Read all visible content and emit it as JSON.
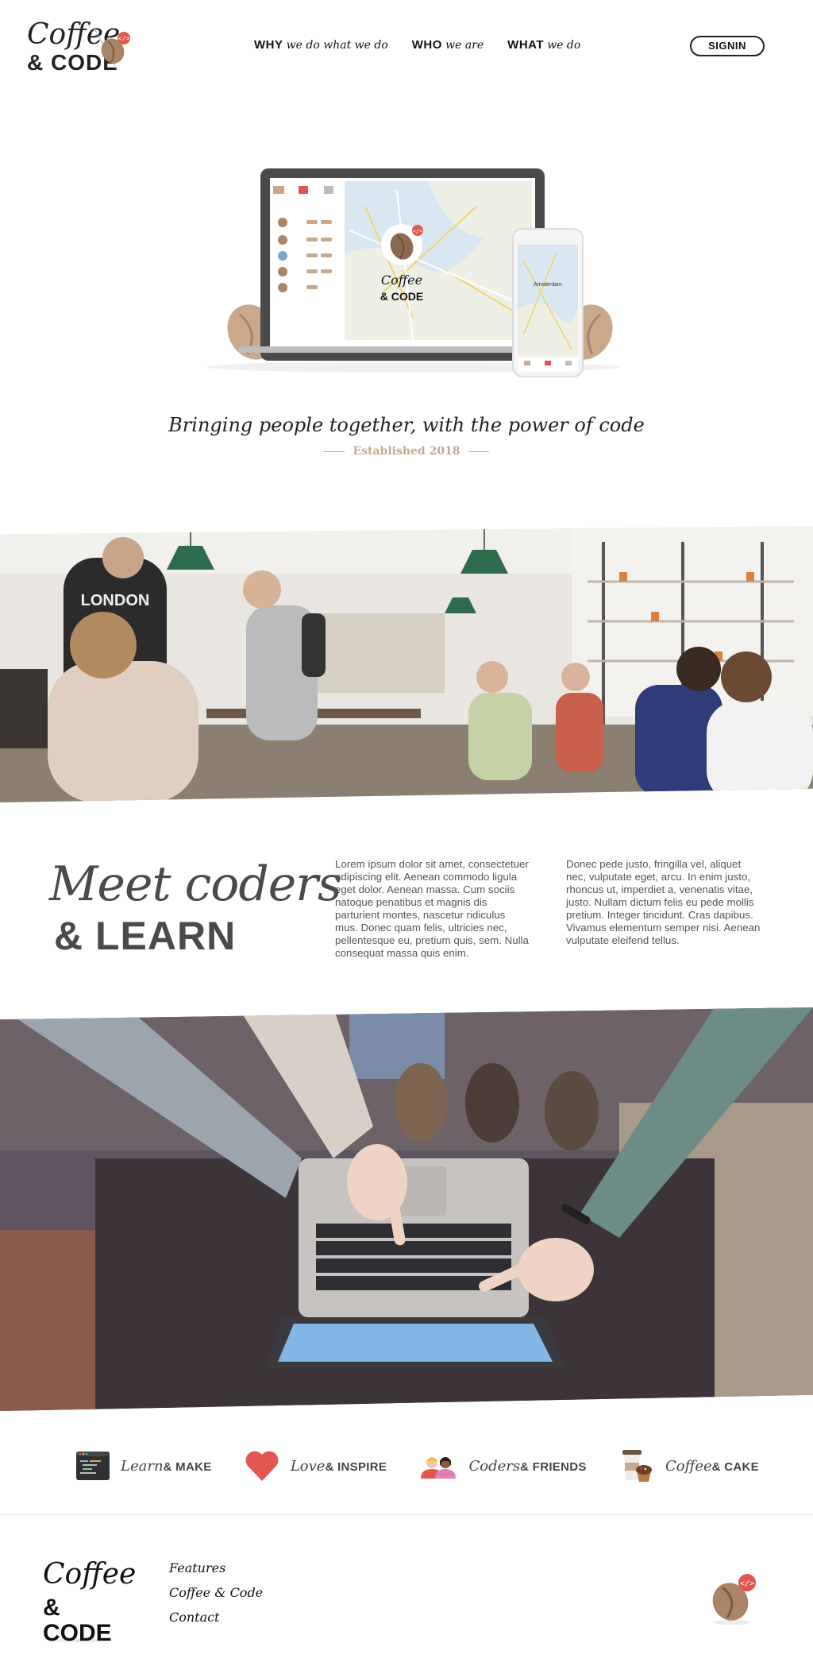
{
  "brand": {
    "line1": "Coffee",
    "line2": "& CODE"
  },
  "nav": [
    {
      "key": "WHY",
      "sub": "we do what we do"
    },
    {
      "key": "WHO",
      "sub": "we are"
    },
    {
      "key": "WHAT",
      "sub": "we do"
    }
  ],
  "signin_label": "SIGNIN",
  "hero": {
    "tagline": "Bringing people together, with the power of code",
    "established": "Established 2018",
    "device_logo_line1": "Coffee",
    "device_logo_line2": "& CODE",
    "phone_city": "Amsterdam"
  },
  "meet": {
    "title_script": "Meet coders",
    "title_bold": "& LEARN",
    "paragraph1": "Lorem ipsum dolor sit amet, consectetuer adipiscing elit. Aenean commodo ligula eget dolor. Aenean massa. Cum sociis natoque penatibus et magnis dis parturient montes, nascetur ridiculus mus. Donec quam felis, ultricies nec, pellentesque eu, pretium quis, sem. Nulla consequat massa quis enim.",
    "paragraph2": "Donec pede justo, fringilla vel, aliquet nec, vulputate eget, arcu. In enim justo, rhoncus ut, imperdiet a, venenatis vitae, justo. Nullam dictum felis eu pede mollis pretium. Integer tincidunt. Cras dapibus. Vivamus elementum semper nisi. Aenean vulputate eleifend tellus."
  },
  "features": [
    {
      "script": "Learn",
      "bold": "& MAKE",
      "icon": "code-editor-icon"
    },
    {
      "script": "Love",
      "bold": "& INSPIRE",
      "icon": "heart-icon"
    },
    {
      "script": "Coders",
      "bold": "& FRIENDS",
      "icon": "people-icon"
    },
    {
      "script": "Coffee",
      "bold": "& CAKE",
      "icon": "coffee-cup-icon"
    }
  ],
  "footer": {
    "logo_line1": "Coffee",
    "logo_line2": "& CODE",
    "links": [
      "Features",
      "Coffee & Code",
      "Contact"
    ]
  },
  "colors": {
    "accent_red": "#e2564f",
    "bean_brown": "#a98467",
    "tan": "#c9a88b",
    "text_dark": "#222222"
  }
}
